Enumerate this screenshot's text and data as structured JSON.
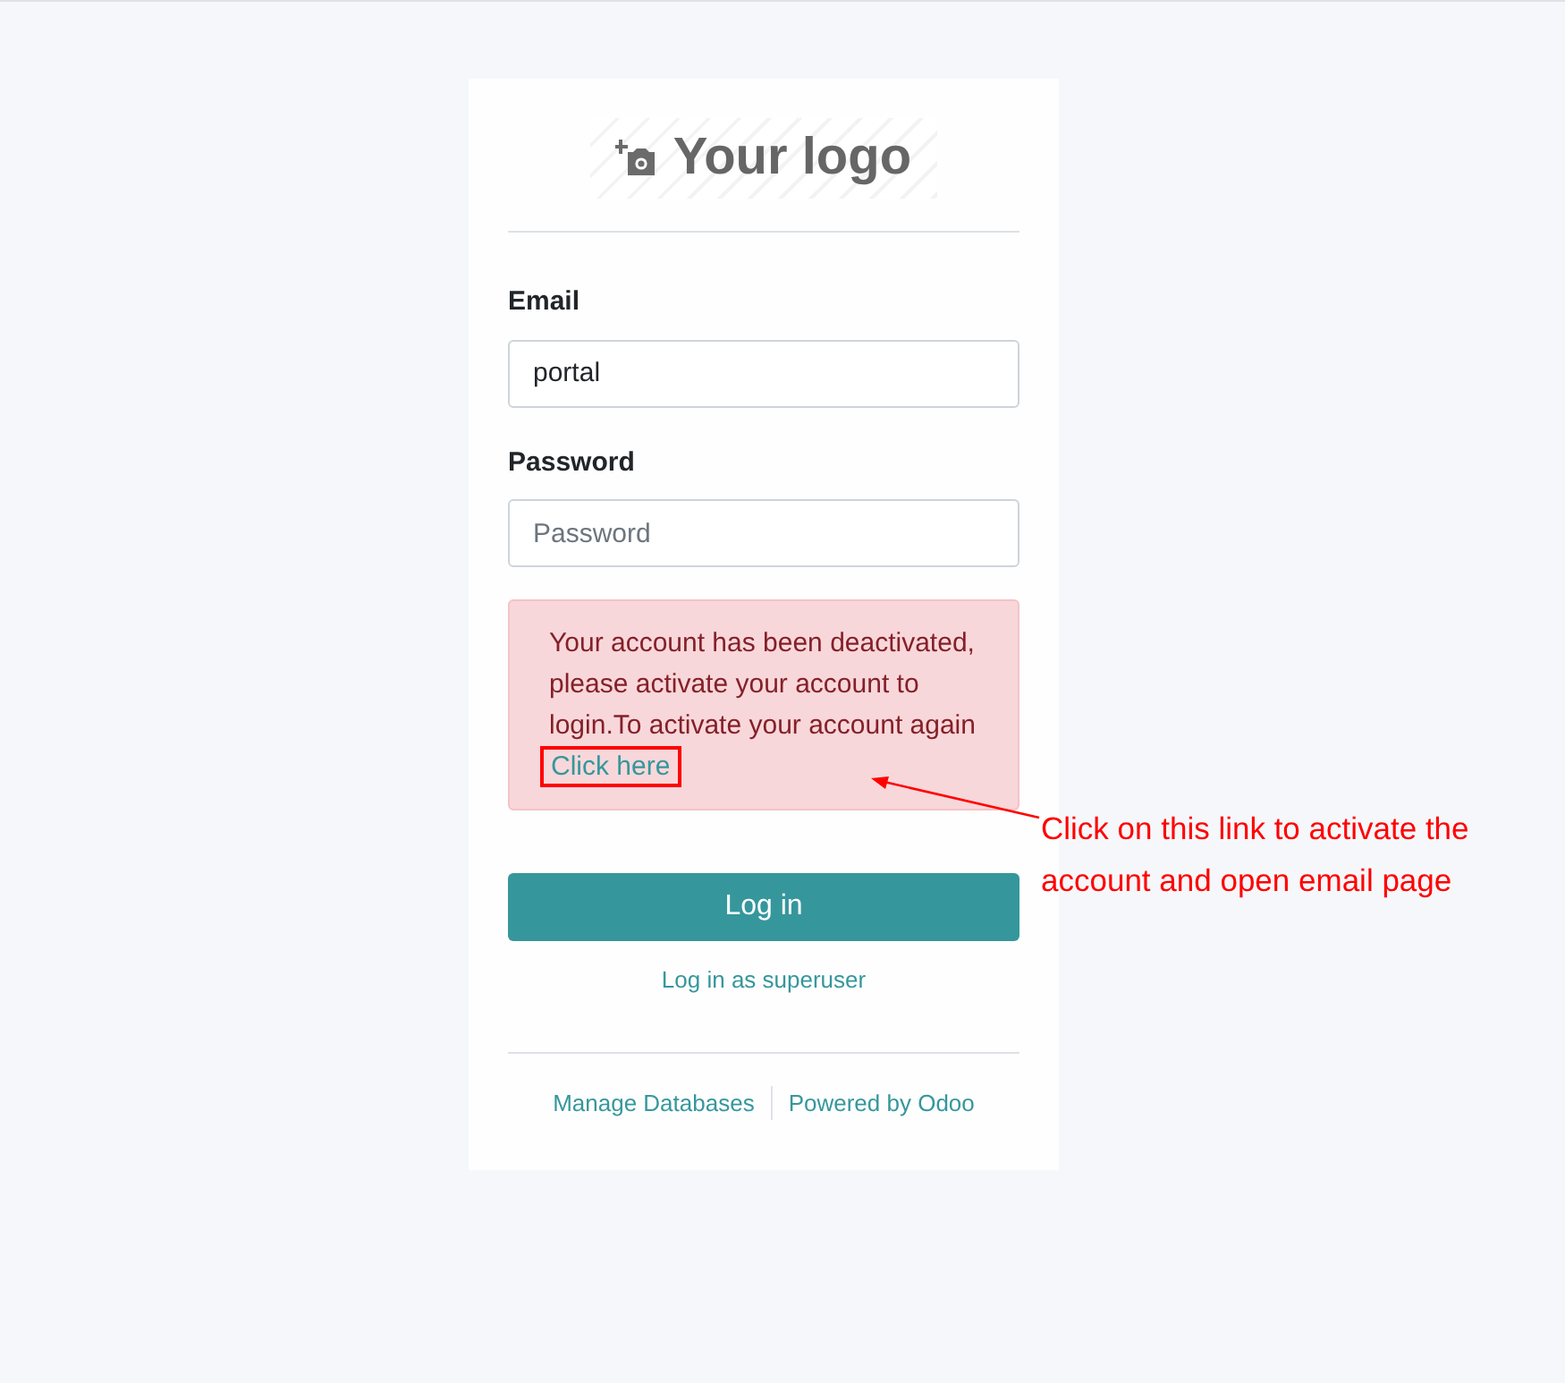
{
  "logo": {
    "text": "Your logo"
  },
  "fields": [
    {
      "label": "Email",
      "value": "portal"
    },
    {
      "label": "Password",
      "placeholder": "Password"
    }
  ],
  "alert": {
    "message": "Your account has been deactivated, please activate your account to login.To activate your account again",
    "link": "Click here"
  },
  "annotation": {
    "text": "Click on this link to activate the account and open email page"
  },
  "login_button": "Log in",
  "superuser_link": "Log in as superuser",
  "footer_links": [
    "Manage Databases",
    "Powered by Odoo"
  ]
}
